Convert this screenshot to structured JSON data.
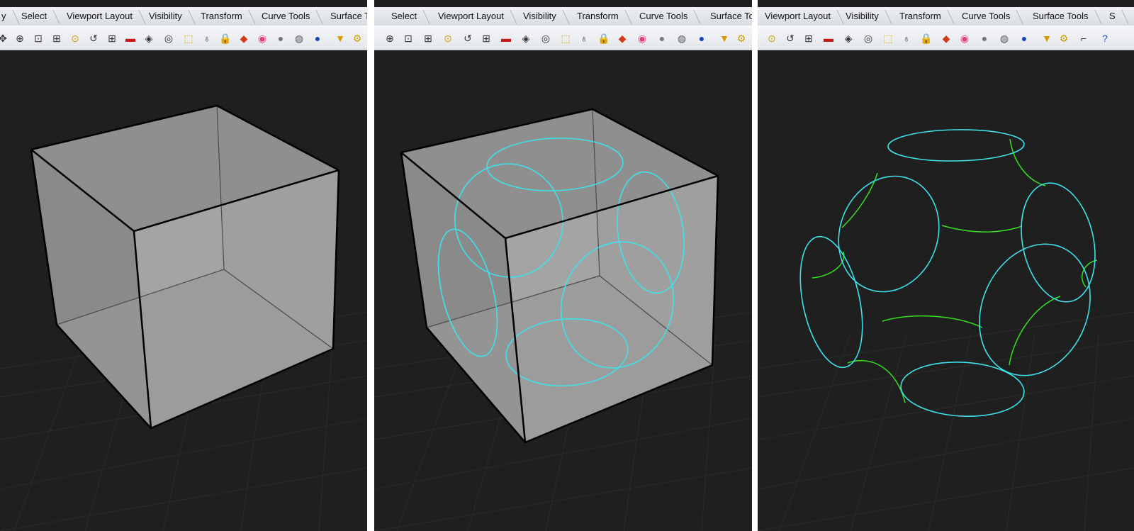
{
  "tabs_panel1": [
    "y",
    "Select",
    "Viewport Layout",
    "Visibility",
    "Transform",
    "Curve Tools",
    "Surface T"
  ],
  "tabs_panel2": [
    "Select",
    "Viewport Layout",
    "Visibility",
    "Transform",
    "Curve Tools",
    "Surface To"
  ],
  "tabs_panel3": [
    "Viewport Layout",
    "Visibility",
    "Transform",
    "Curve Tools",
    "Surface Tools",
    "S"
  ],
  "toolbar_icons": [
    "pan-icon",
    "zoom-icon",
    "zoom-window-icon",
    "zoom-extents-icon",
    "zoom-selected-icon",
    "rotate-view-icon",
    "four-viewports-icon",
    "car-icon",
    "named-view-icon",
    "target-icon",
    "gumball-icon",
    "lightbulb-icon",
    "lock-icon",
    "render-icon",
    "color-wheel-icon",
    "sphere-shaded-icon",
    "sphere-rendered-icon",
    "sphere-blue-icon",
    "filter-icon",
    "settings-gear-icon",
    "dimension-icon",
    "help-icon"
  ],
  "colors": {
    "viewport_bg": "#1f1f1f",
    "grid": "#2c2c2c",
    "cube_face_front": "#9a9a9a",
    "cube_face_back": "#6e6e6e",
    "cube_edge": "#000000",
    "circle_cyan": "#40e0e8",
    "curve_green": "#34e020"
  }
}
